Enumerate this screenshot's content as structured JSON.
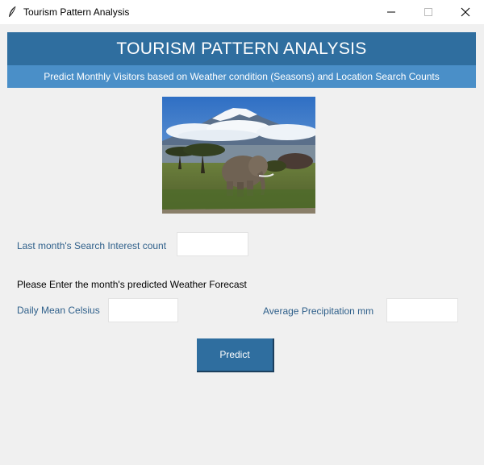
{
  "window": {
    "title": "Tourism Pattern Analysis",
    "app_icon": "feather-icon",
    "controls": [
      "minimize-icon",
      "maximize-icon",
      "close-icon"
    ]
  },
  "header": {
    "title": "TOURISM PATTERN ANALYSIS",
    "subtitle": "Predict Monthly Visitors based on Weather condition (Seasons) and Location Search Counts"
  },
  "image": {
    "subject": "elephant-kilimanjaro-photo"
  },
  "form": {
    "search_label": "Last month's Search Interest count",
    "search_value": "",
    "forecast_prompt": "Please Enter the month's predicted Weather Forecast",
    "celsius_label": "Daily Mean Celsius",
    "celsius_value": "",
    "precip_label": "Average Precipitation mm",
    "precip_value": "",
    "predict_label": "Predict"
  },
  "colors": {
    "header_bg": "#2f6e9f",
    "subheader_bg": "#4a8fc8",
    "label_text": "#2e5f8a",
    "window_bg": "#f0f0f0"
  }
}
